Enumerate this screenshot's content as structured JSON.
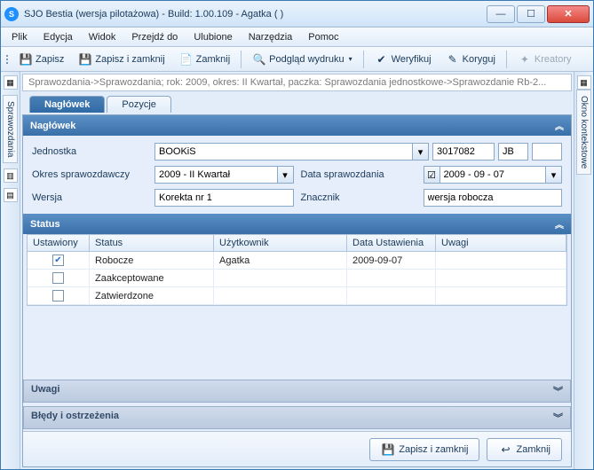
{
  "window": {
    "title": "SJO Bestia (wersja pilotażowa) - Build: 1.00.109 - Agatka ( )"
  },
  "menu": {
    "plik": "Plik",
    "edycja": "Edycja",
    "widok": "Widok",
    "przejdz": "Przejdź do",
    "ulubione": "Ulubione",
    "narzedzia": "Narzędzia",
    "pomoc": "Pomoc"
  },
  "toolbar": {
    "zapisz": "Zapisz",
    "zapisz_zamknij": "Zapisz i zamknij",
    "zamknij": "Zamknij",
    "podglad": "Podgląd wydruku",
    "weryfikuj": "Weryfikuj",
    "koryguj": "Koryguj",
    "kreatory": "Kreatory"
  },
  "sidebar": {
    "sprawozdania": "Sprawozdania",
    "okno": "Okno kontekstowe"
  },
  "breadcrumb": "Sprawozdania->Sprawozdania; rok: 2009, okres: II Kwartał, paczka: Sprawozdania jednostkowe->Sprawozdanie Rb-2...",
  "tabs": {
    "naglowek": "Nagłówek",
    "pozycje": "Pozycje"
  },
  "section": {
    "naglowek": "Nagłówek",
    "status": "Status",
    "uwagi": "Uwagi",
    "bledy": "Błędy i ostrzeżenia"
  },
  "form": {
    "jednostka_lbl": "Jednostka",
    "jednostka_val": "BOOKiS",
    "jednostka_code": "3017082",
    "jednostka_short": "JB",
    "okres_lbl": "Okres sprawozdawczy",
    "okres_val": "2009 - II Kwartał",
    "data_lbl": "Data sprawozdania",
    "data_val": "2009 - 09 - 07",
    "wersja_lbl": "Wersja",
    "wersja_val": "Korekta nr 1",
    "znacznik_lbl": "Znacznik",
    "znacznik_val": "wersja robocza"
  },
  "table": {
    "headers": {
      "ustawiony": "Ustawiony",
      "status": "Status",
      "uzytkownik": "Użytkownik",
      "data": "Data Ustawienia",
      "uwagi": "Uwagi"
    },
    "rows": [
      {
        "checked": true,
        "status": "Robocze",
        "user": "Agatka",
        "data": "2009-09-07",
        "uwagi": ""
      },
      {
        "checked": false,
        "status": "Zaakceptowane",
        "user": "",
        "data": "",
        "uwagi": ""
      },
      {
        "checked": false,
        "status": "Zatwierdzone",
        "user": "",
        "data": "",
        "uwagi": ""
      }
    ]
  },
  "footer": {
    "zapisz_zamknij": "Zapisz i zamknij",
    "zamknij": "Zamknij"
  }
}
